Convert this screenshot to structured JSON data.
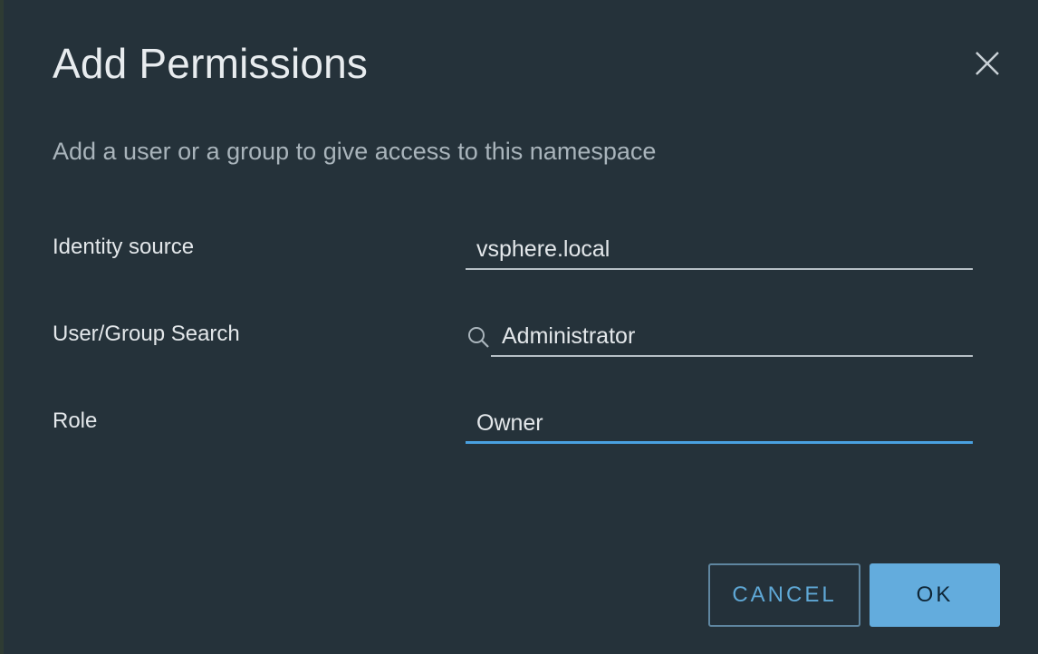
{
  "dialog": {
    "title": "Add Permissions",
    "subtitle": "Add a user or a group to give access to this namespace",
    "close_icon": "close-icon"
  },
  "form": {
    "identity_source": {
      "label": "Identity source",
      "value": "vsphere.local"
    },
    "user_group_search": {
      "label": "User/Group Search",
      "value": "Administrator",
      "icon": "search-icon"
    },
    "role": {
      "label": "Role",
      "value": "Owner",
      "focused": true
    }
  },
  "actions": {
    "cancel_label": "CANCEL",
    "ok_label": "OK"
  },
  "colors": {
    "background": "#25323a",
    "accent": "#49a1e0",
    "primary_button": "#63acdd"
  }
}
